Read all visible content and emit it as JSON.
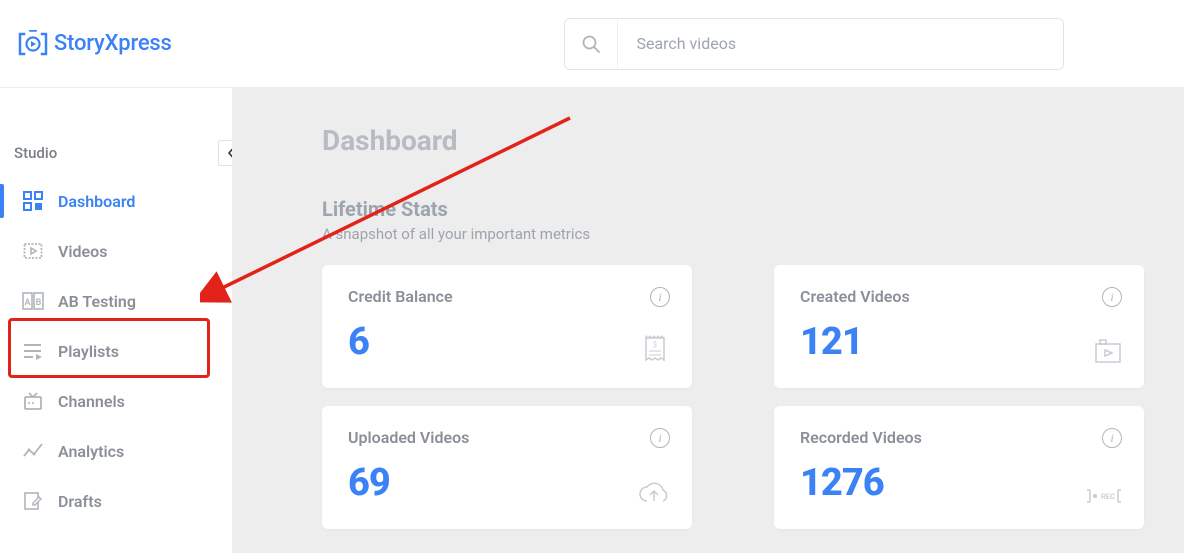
{
  "brand": "StoryXpress",
  "search": {
    "placeholder": "Search videos"
  },
  "sidebar": {
    "title": "Studio",
    "items": [
      {
        "label": "Dashboard"
      },
      {
        "label": "Videos"
      },
      {
        "label": "AB Testing"
      },
      {
        "label": "Playlists"
      },
      {
        "label": "Channels"
      },
      {
        "label": "Analytics"
      },
      {
        "label": "Drafts"
      }
    ]
  },
  "page": {
    "title": "Dashboard",
    "section_title": "Lifetime Stats",
    "section_sub": "A snapshot of all your important metrics"
  },
  "cards": {
    "credit": {
      "label": "Credit Balance",
      "value": "6"
    },
    "created": {
      "label": "Created Videos",
      "value": "121"
    },
    "uploaded": {
      "label": "Uploaded Videos",
      "value": "69"
    },
    "recorded": {
      "label": "Recorded Videos",
      "value": "1276"
    }
  }
}
